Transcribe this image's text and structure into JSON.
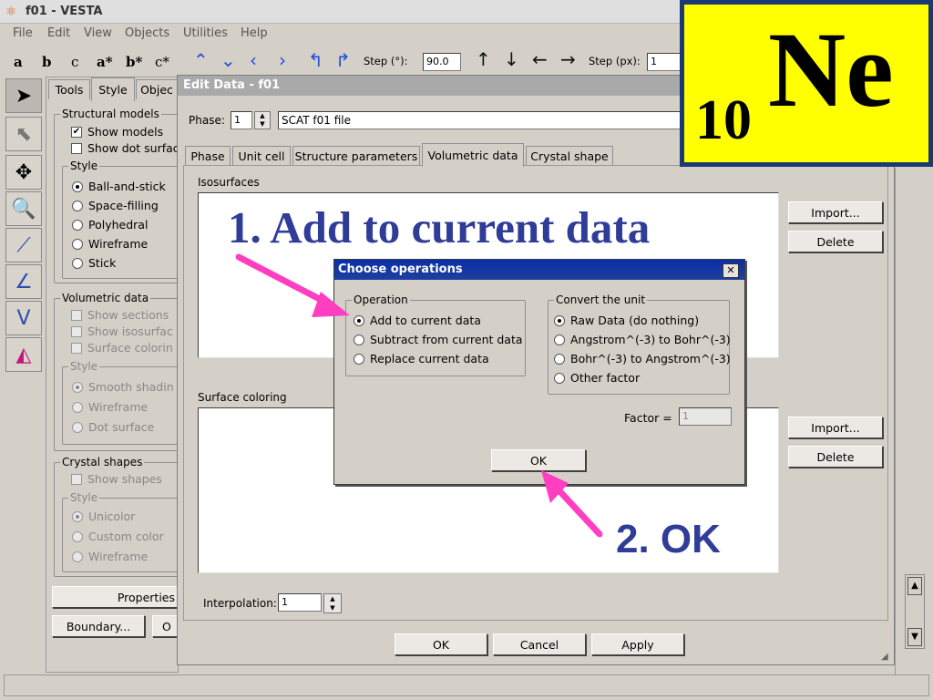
{
  "app": {
    "title": "f01 - VESTA"
  },
  "menu": [
    "File",
    "Edit",
    "View",
    "Objects",
    "Utilities",
    "Help"
  ],
  "toolbar": {
    "axes": [
      "a",
      "b",
      "c",
      "a*",
      "b*",
      "c*"
    ],
    "step_deg_label": "Step (°):",
    "step_deg_value": "90.0",
    "step_px_label": "Step (px):",
    "step_px_value": "1"
  },
  "side_panel": {
    "tabs": [
      "Tools",
      "Style",
      "Objec"
    ],
    "structural_models": {
      "title": "Structural models",
      "show_models": "Show models",
      "show_dots": "Show dot surfac",
      "style_title": "Style",
      "styles": [
        "Ball-and-stick",
        "Space-filling",
        "Polyhedral",
        "Wireframe",
        "Stick"
      ]
    },
    "volumetric_data": {
      "title": "Volumetric data",
      "show_sections": "Show sections",
      "show_isosurface": "Show isosurfac",
      "surface_coloring": "Surface colorin",
      "style_title": "Style",
      "styles": [
        "Smooth shadin",
        "Wireframe",
        "Dot surface"
      ]
    },
    "crystal_shapes": {
      "title": "Crystal shapes",
      "show_shapes": "Show shapes",
      "style_title": "Style",
      "styles": [
        "Unicolor",
        "Custom color",
        "Wireframe"
      ]
    },
    "properties_button": "Properties",
    "boundary_button": "Boundary...",
    "o_button": "O"
  },
  "edit_data": {
    "title": "Edit Data - f01",
    "phase_label": "Phase:",
    "phase_value": "1",
    "phase_name": "SCAT f01 file",
    "tabs": [
      "Phase",
      "Unit cell",
      "Structure parameters",
      "Volumetric data",
      "Crystal shape"
    ],
    "isosurfaces_label": "Isosurfaces",
    "surface_coloring_label": "Surface coloring",
    "import_button": "Import...",
    "delete_button": "Delete",
    "interpolation_label": "Interpolation:",
    "interpolation_value": "1",
    "ok_button": "OK",
    "cancel_button": "Cancel",
    "apply_button": "Apply"
  },
  "dialog": {
    "title": "Choose operations",
    "close": "✕",
    "operation_title": "Operation",
    "operations": [
      "Add to current data",
      "Subtract from current data",
      "Replace current data"
    ],
    "unit_title": "Convert the unit",
    "units": [
      "Raw Data (do nothing)",
      "Angstrom^(-3) to Bohr^(-3)",
      "Bohr^(-3) to Angstrom^(-3)",
      "Other factor"
    ],
    "factor_label": "Factor =",
    "factor_value": "1",
    "ok_button": "OK"
  },
  "annotations": {
    "step1": "1. Add to current data",
    "step2": "2. OK"
  },
  "badge": {
    "atomic_number": "10",
    "symbol": "Ne"
  },
  "colors": {
    "annotation": "#2f3c98",
    "arrow": "#ff3fc0",
    "badge_bg": "#ffff00",
    "badge_border": "#1b3a73",
    "dialog_title": "#0b2fa8",
    "toolbar_arrow": "#1f4fd8"
  }
}
